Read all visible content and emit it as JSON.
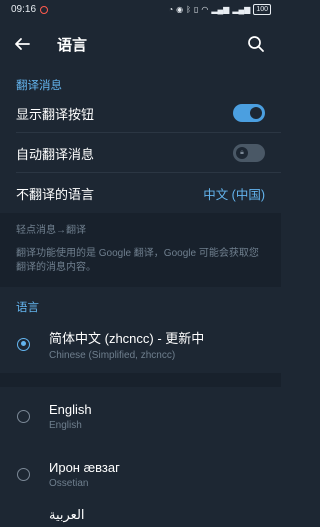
{
  "status": {
    "time": "09:16",
    "battery": "100"
  },
  "header": {
    "title": "语言"
  },
  "translate": {
    "section_title": "翻译消息",
    "show_button_label": "显示翻译按钮",
    "show_button_on": true,
    "auto_translate_label": "自动翻译消息",
    "auto_translate_on": false,
    "no_translate_label": "不翻译的语言",
    "no_translate_value": "中文 (中国)",
    "info_subtitle": "轻点消息→翻译",
    "info_text": "翻译功能使用的是 Google 翻译，Google 可能会获取您翻译的消息内容。"
  },
  "language": {
    "section_title": "语言",
    "items": [
      {
        "name": "简体中文 (zhcncc) - 更新中",
        "native": "Chinese (Simplified, zhcncc)",
        "selected": true
      },
      {
        "name": "English",
        "native": "English",
        "selected": false
      },
      {
        "name": "Ирон æвзаг",
        "native": "Ossetian",
        "selected": false
      },
      {
        "name": "العربية",
        "native": "",
        "selected": false
      }
    ]
  },
  "colors": {
    "accent": "#64b5ef",
    "background": "#1d2733",
    "switch_on": "#4b9fe0"
  }
}
